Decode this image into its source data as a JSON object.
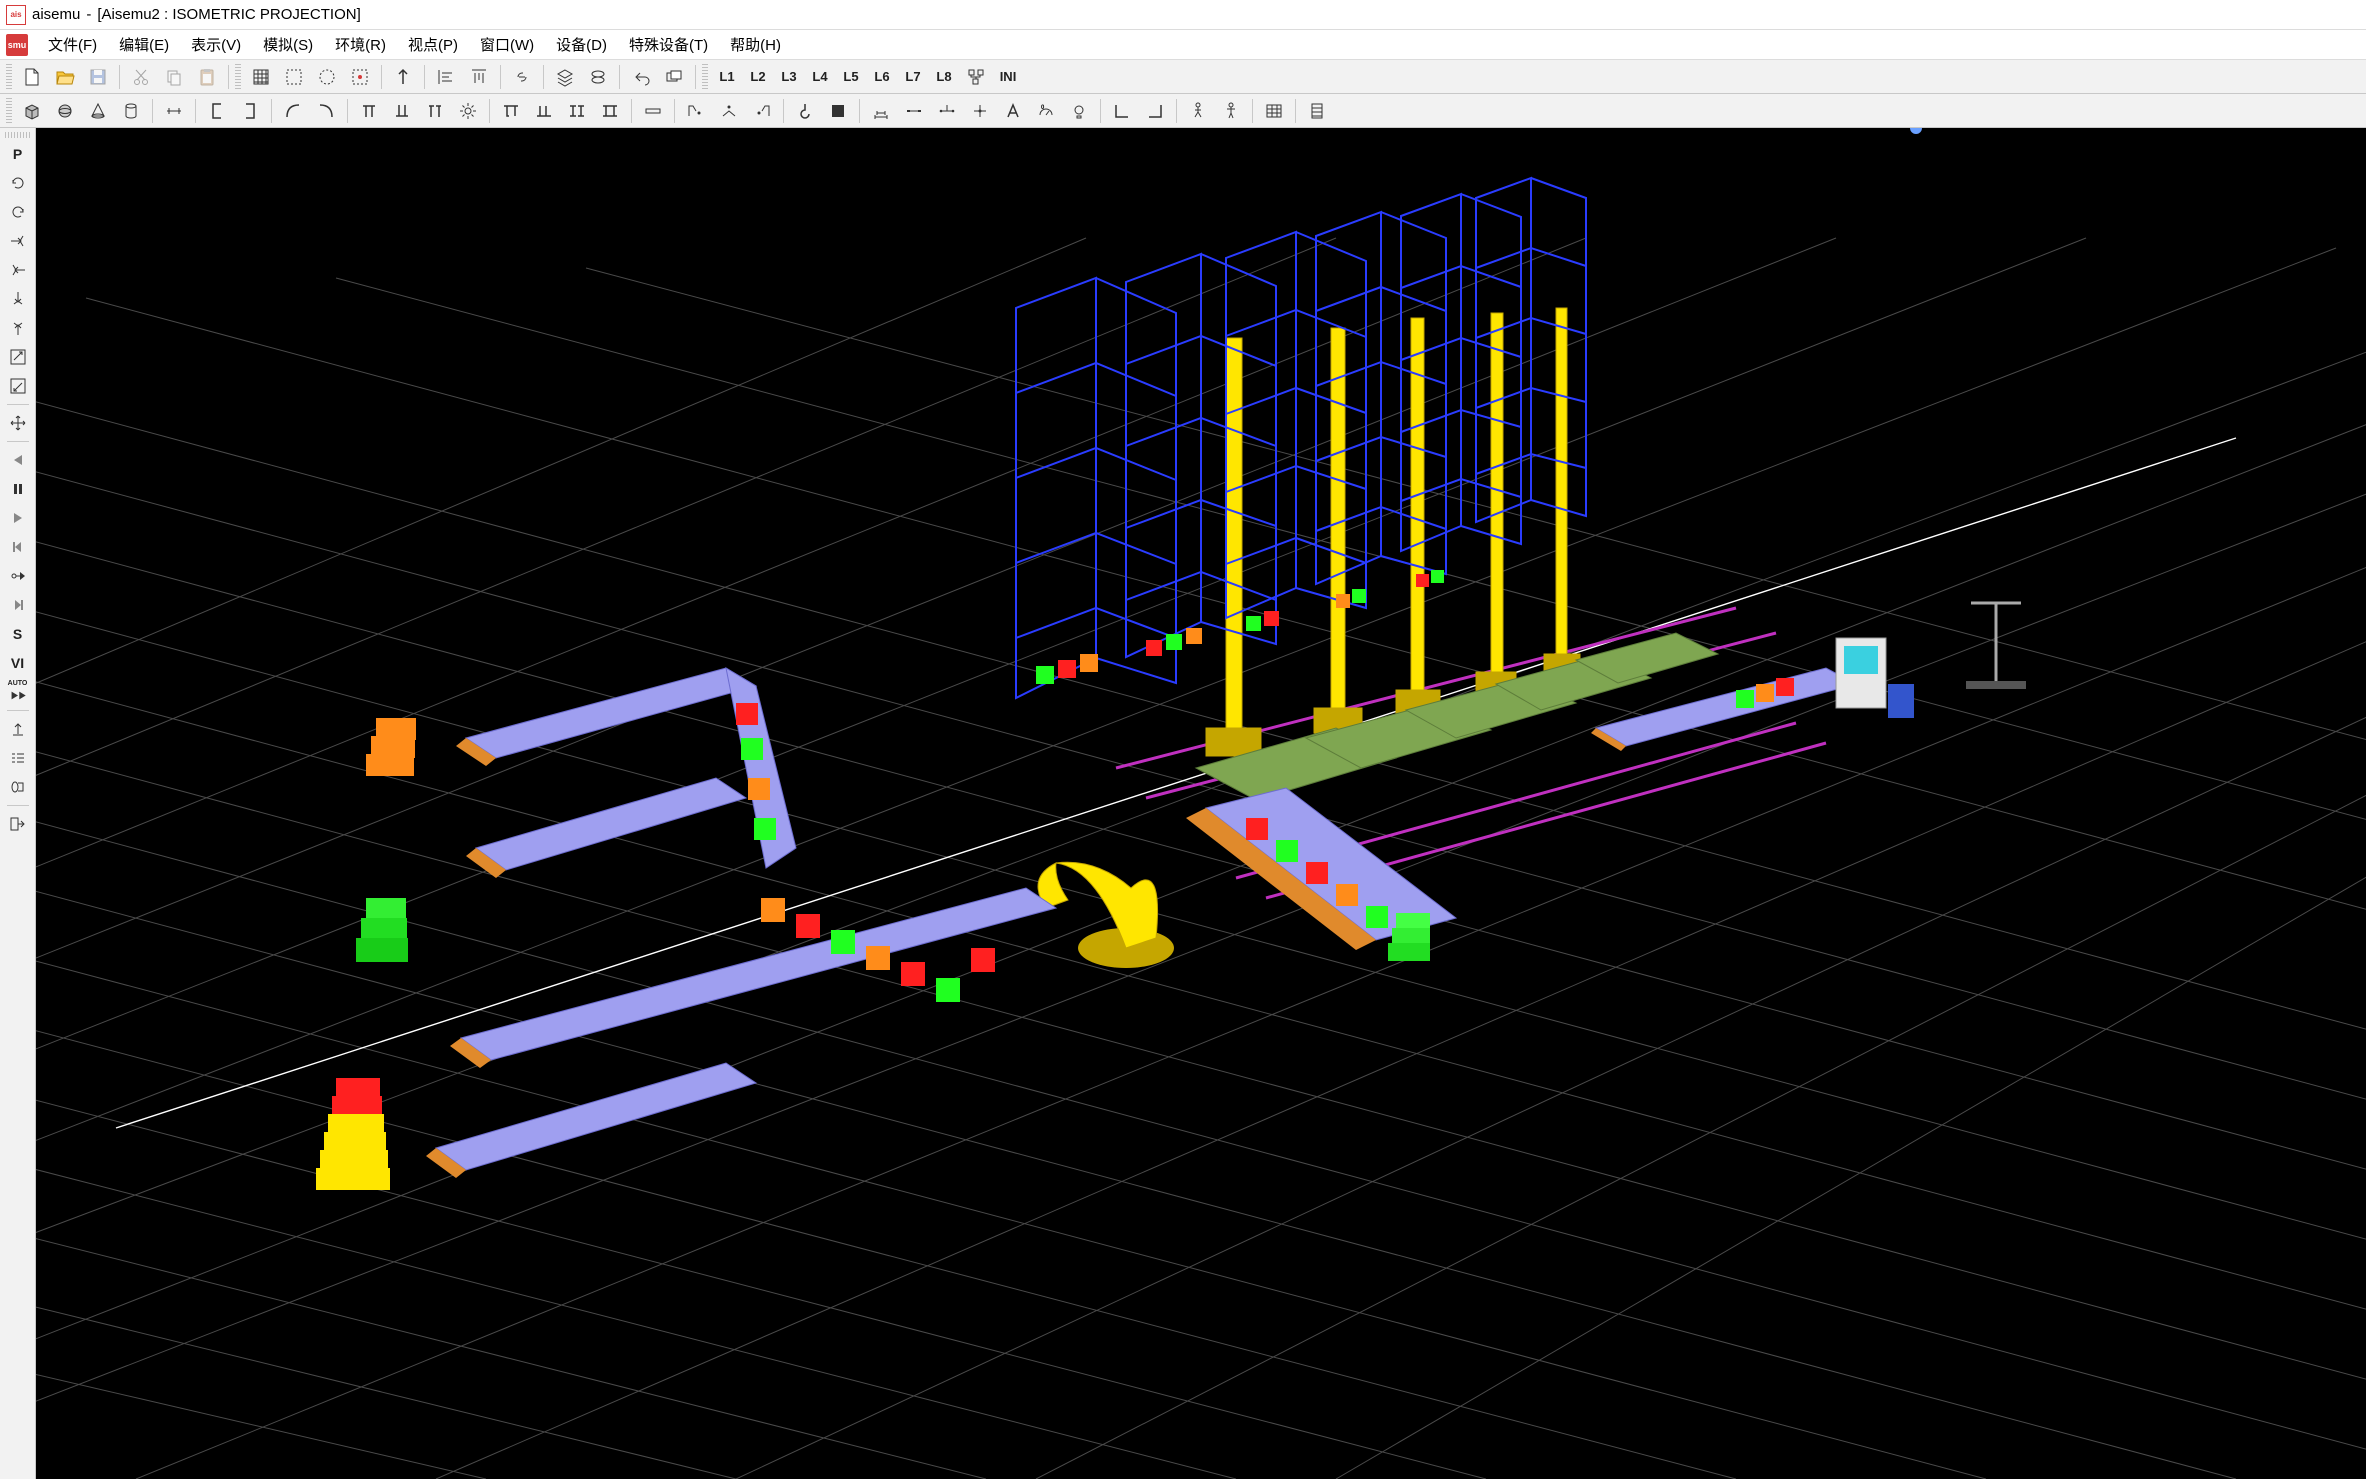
{
  "window": {
    "app_name": "aisemu",
    "doc_title": "[Aisemu2 : ISOMETRIC PROJECTION]"
  },
  "menu": {
    "items": [
      {
        "label": "文件(F)",
        "hotkey": "F"
      },
      {
        "label": "编辑(E)",
        "hotkey": "E"
      },
      {
        "label": "表示(V)",
        "hotkey": "V"
      },
      {
        "label": "模拟(S)",
        "hotkey": "S"
      },
      {
        "label": "环境(R)",
        "hotkey": "R"
      },
      {
        "label": "视点(P)",
        "hotkey": "P"
      },
      {
        "label": "窗口(W)",
        "hotkey": "W"
      },
      {
        "label": "设备(D)",
        "hotkey": "D"
      },
      {
        "label": "特殊设备(T)",
        "hotkey": "T"
      },
      {
        "label": "帮助(H)",
        "hotkey": "H"
      }
    ]
  },
  "toolbar1": {
    "layers": [
      "L1",
      "L2",
      "L3",
      "L4",
      "L5",
      "L6",
      "L7",
      "L8"
    ],
    "ini_label": "INI"
  },
  "side": {
    "p_label": "P",
    "s_label": "S",
    "vi_label": "VI",
    "auto_label": "AUTO"
  },
  "colors": {
    "rack": "#2a3cff",
    "conveyor_deck": "#9f9ff0",
    "conveyor_rail": "#e08a2c",
    "crane_mast": "#ffff00",
    "crane_base": "#c5a600",
    "robot": "#ffe600",
    "floor_grid": "#505050",
    "purple_line": "#c030c0",
    "pallet": "#7fa651",
    "box_red": "#ff2020",
    "box_green": "#20ff20",
    "box_orange": "#ff8c1a",
    "box_yellow": "#ffe600"
  }
}
